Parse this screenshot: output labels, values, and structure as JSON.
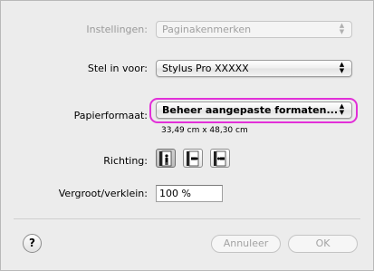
{
  "settings": {
    "label": "Instellingen:",
    "value": "Paginakenmerken"
  },
  "format_for": {
    "label": "Stel in voor:",
    "value": "Stylus Pro XXXXX"
  },
  "paper_size": {
    "label": "Papierformaat:",
    "value": "Beheer aangepaste formaten...",
    "dimensions": "33,49 cm x 48,30 cm",
    "highlight_color": "#e22fd8"
  },
  "orientation": {
    "label": "Richting:",
    "options": [
      {
        "name": "portrait",
        "icon": "portrait-orientation-icon",
        "selected": true
      },
      {
        "name": "landscape",
        "icon": "landscape-orientation-icon",
        "selected": false
      },
      {
        "name": "landscape-reversed",
        "icon": "landscape-reversed-orientation-icon",
        "selected": false
      }
    ]
  },
  "scale": {
    "label": "Vergroot/verklein:",
    "value": "100 %"
  },
  "buttons": {
    "help": "?",
    "cancel": "Annuleer",
    "ok": "OK"
  }
}
